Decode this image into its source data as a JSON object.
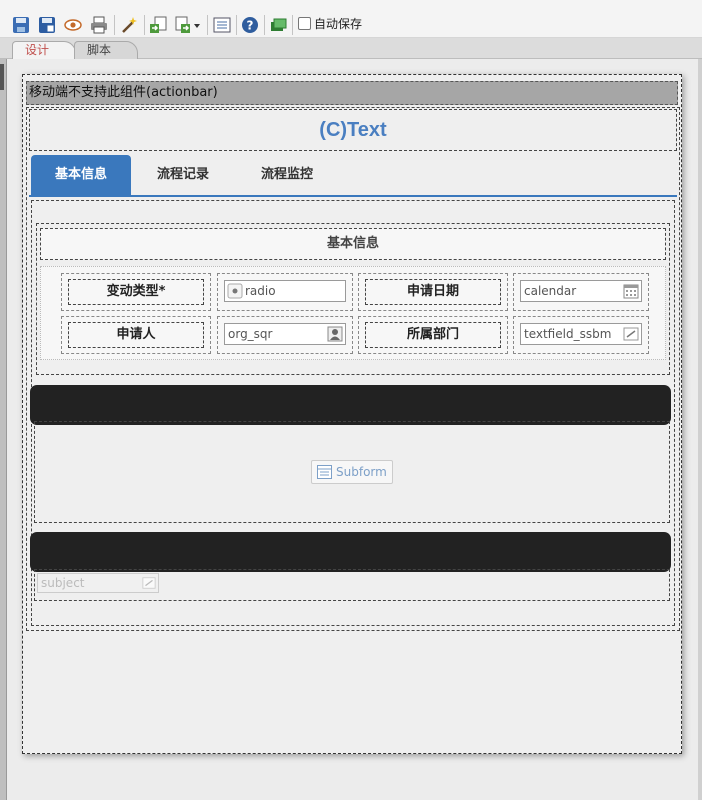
{
  "toolbar": {
    "icons": [
      "save-icon",
      "save-as-icon",
      "preview-icon",
      "print-icon",
      "wand-icon",
      "import-icon",
      "export-icon",
      "list-icon",
      "help-icon",
      "layers-icon"
    ],
    "autosave_label": "自动保存",
    "autosave_checked": false
  },
  "editor_tabs": [
    {
      "label": "设计",
      "active": true
    },
    {
      "label": "脚本",
      "active": false
    }
  ],
  "actionbar_notice": "移动端不支持此组件(actionbar)",
  "form": {
    "title": "(C)Text",
    "tabs": [
      {
        "label": "基本信息",
        "active": true
      },
      {
        "label": "流程记录",
        "active": false
      },
      {
        "label": "流程监控",
        "active": false
      }
    ],
    "section_title": "基本信息",
    "rows": [
      {
        "label1": "变动类型*",
        "field1": "radio",
        "field1_icon": "radio-icon",
        "label2": "申请日期",
        "field2": "calendar",
        "field2_icon": "calendar-icon"
      },
      {
        "label1": "申请人",
        "field1": "org_sqr",
        "field1_icon": "person-icon",
        "label2": "所属部门",
        "field2": "textfield_ssbm",
        "field2_icon": "edit-icon"
      }
    ],
    "subform_label": "Subform",
    "subject_placeholder": "subject"
  },
  "colors": {
    "accent": "#3a78bd",
    "title": "#4a7fc1",
    "dark_bar": "#222222",
    "actionbar_bg": "#a6a6a6"
  }
}
